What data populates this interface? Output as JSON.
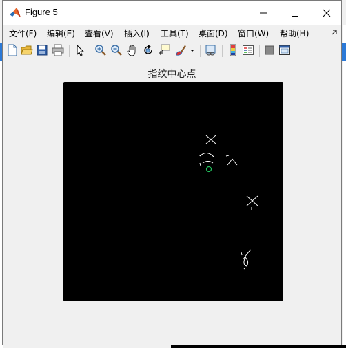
{
  "window": {
    "title": "Figure 5"
  },
  "menu": {
    "items": [
      "文件(F)",
      "编辑(E)",
      "查看(V)",
      "插入(I)",
      "工具(T)",
      "桌面(D)",
      "窗口(W)",
      "帮助(H)"
    ]
  },
  "toolbar": {
    "icons": [
      "new-figure-icon",
      "open-file-icon",
      "save-icon",
      "print-icon",
      "edit-plot-arrow-icon",
      "zoom-in-icon",
      "zoom-out-icon",
      "pan-hand-icon",
      "rotate-3d-icon",
      "data-cursor-icon",
      "brush-icon",
      "brush-dropdown-icon",
      "link-plot-icon",
      "colorbar-icon",
      "legend-icon",
      "hide-plot-tools-icon",
      "show-plot-tools-icon"
    ]
  },
  "figure": {
    "title": "指纹中心点",
    "background": "#000000",
    "marker_color": "#22c55e",
    "stroke_color": "#ffffff"
  }
}
